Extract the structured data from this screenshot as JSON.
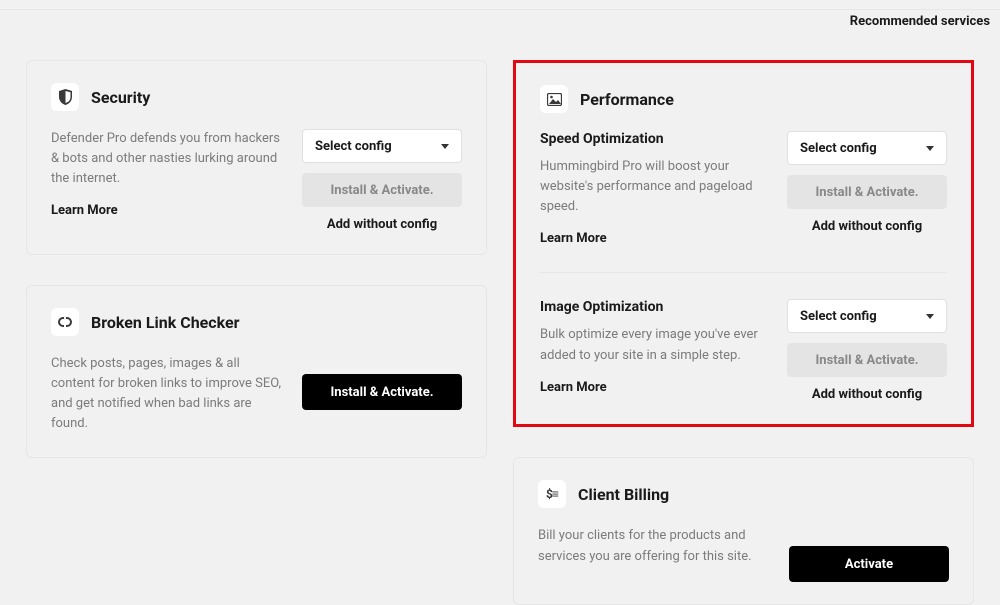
{
  "header": {
    "recommended": "Recommended services"
  },
  "common": {
    "select_config": "Select config",
    "install_activate": "Install & Activate.",
    "add_without_config": "Add without config",
    "learn_more": "Learn More",
    "activate": "Activate"
  },
  "security": {
    "title": "Security",
    "desc": "Defender Pro defends you from hackers & bots and other nasties lurking around the internet."
  },
  "blc": {
    "title": "Broken Link Checker",
    "desc": "Check posts, pages, images & all content for broken links to improve SEO, and get notified when bad links are found."
  },
  "performance": {
    "title": "Performance",
    "speed": {
      "title": "Speed Optimization",
      "desc": "Hummingbird Pro will boost your website's performance and pageload speed."
    },
    "image": {
      "title": "Image Optimization",
      "desc": "Bulk optimize every image you've ever added to your site in a simple step."
    }
  },
  "billing": {
    "title": "Client Billing",
    "desc": "Bill your clients for the products and services you are offering for this site."
  }
}
